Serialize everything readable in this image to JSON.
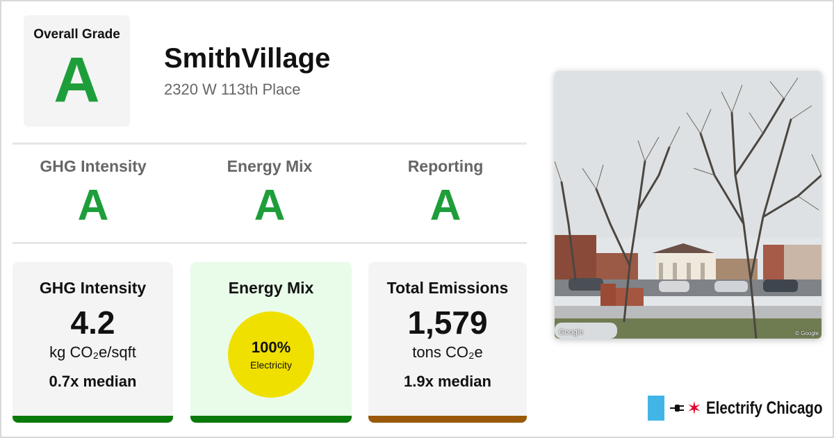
{
  "overall": {
    "label": "Overall Grade",
    "grade": "A"
  },
  "building": {
    "name": "SmithVillage",
    "address": "2320 W 113th Place"
  },
  "subgrades": [
    {
      "label": "GHG Intensity",
      "grade": "A"
    },
    {
      "label": "Energy Mix",
      "grade": "A"
    },
    {
      "label": "Reporting",
      "grade": "A"
    }
  ],
  "cards": {
    "ghg": {
      "title": "GHG Intensity",
      "value": "4.2",
      "unit": "kg CO₂e/sqft",
      "median": "0.7x median"
    },
    "mix": {
      "title": "Energy Mix",
      "percent": "100%",
      "source": "Electricity"
    },
    "emissions": {
      "title": "Total Emissions",
      "value": "1,579",
      "unit": "tons CO₂e",
      "median": "1.9x median"
    }
  },
  "photo": {
    "credit": "Google",
    "copyright": "© Google"
  },
  "logo": {
    "text": "Electrify Chicago"
  },
  "colors": {
    "grade_green": "#1e9e3a",
    "bar_ghg": "#0a7a0a",
    "bar_mix": "#0a7a0a",
    "bar_emissions": "#9a5a0a",
    "mix_circle": "#f0e000",
    "logo_blue": "#41b6e6",
    "logo_red": "#e4002b"
  }
}
